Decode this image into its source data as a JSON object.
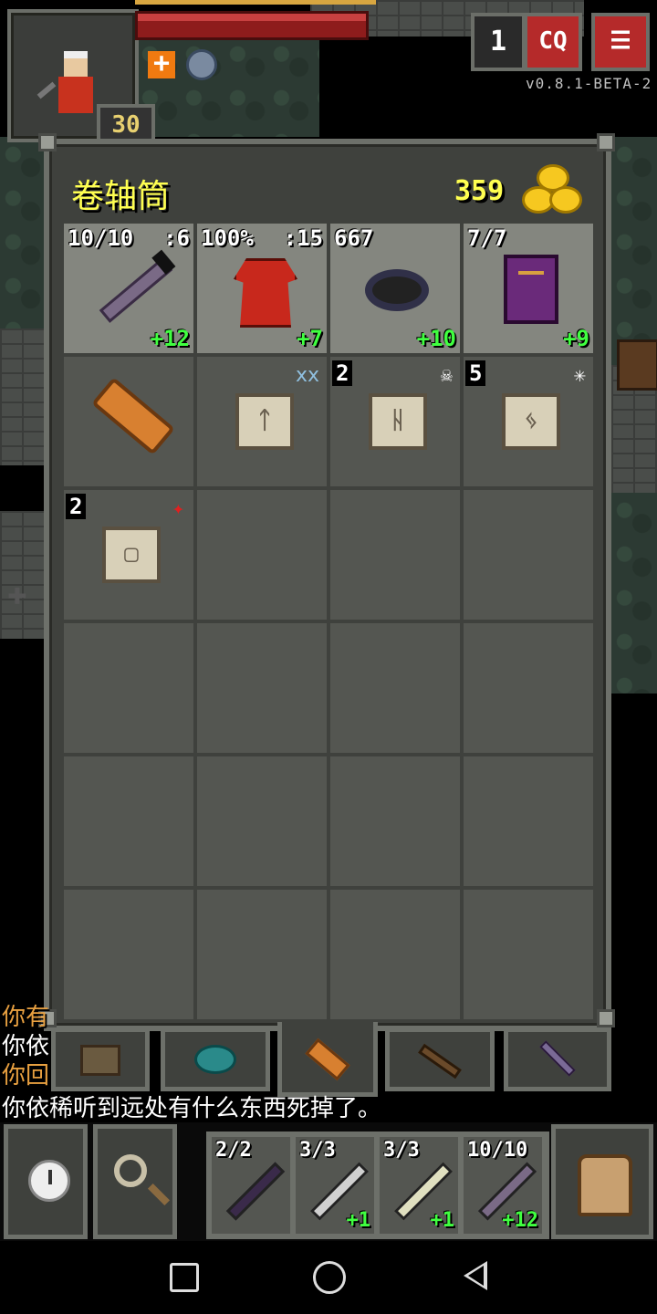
{
  "hud": {
    "level": "30",
    "depth": "1",
    "journal_label": "CQ",
    "menu_label": "☰",
    "version": "v0.8.1-BETA-2"
  },
  "inventory": {
    "title": "卷轴筒",
    "gold": "359",
    "slots": [
      {
        "type": "wand",
        "tl": "10/10",
        "tr": ":6",
        "br": "+12"
      },
      {
        "type": "robe",
        "tl": "100%",
        "tr": ":15",
        "br": "+7"
      },
      {
        "type": "ring",
        "tl": "667",
        "tr": "",
        "br": "+10"
      },
      {
        "type": "book",
        "tl": "7/7",
        "tr": "",
        "br": "+9"
      },
      {
        "type": "holder"
      },
      {
        "type": "scroll",
        "rune": "ᛏ",
        "badge": "ⅹⅹ"
      },
      {
        "type": "scroll",
        "qty": "2",
        "rune": "ᚺ",
        "badge": "☠"
      },
      {
        "type": "scroll",
        "qty": "5",
        "rune": "ᛃ",
        "badge": "✳"
      },
      {
        "type": "scroll",
        "qty": "2",
        "rune": "▢",
        "badge": "✦"
      }
    ]
  },
  "log": [
    {
      "text": "你有",
      "color": "#e8a040"
    },
    {
      "text": "你依",
      "color": "#ffffff"
    },
    {
      "text": "你回",
      "color": "#e8a040"
    },
    {
      "text": "你依稀听到远处有什么东西死掉了。",
      "color": "#ffffff"
    }
  ],
  "quickslots": [
    {
      "tl": "2/2",
      "br": "",
      "color": "#3a2a4a"
    },
    {
      "tl": "3/3",
      "br": "+1",
      "color": "#d0d0d0"
    },
    {
      "tl": "3/3",
      "br": "+1",
      "color": "#e0e0c0"
    },
    {
      "tl": "10/10",
      "br": "+12",
      "color": "#7a6a86"
    }
  ]
}
